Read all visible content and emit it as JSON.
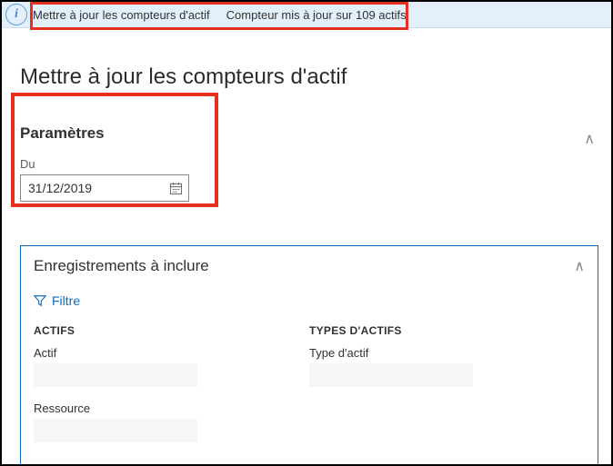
{
  "info_bar": {
    "message_a": "Mettre à jour les compteurs d'actif",
    "message_b": "Compteur mis à jour sur 109 actifs"
  },
  "page_title": "Mettre à jour les compteurs d'actif",
  "params": {
    "section_title": "Paramètres",
    "date_label": "Du",
    "date_value": "31/12/2019"
  },
  "records": {
    "section_title": "Enregistrements à inclure",
    "filter_label": "Filtre",
    "col_a_heading": "ACTIFS",
    "col_a_field1": "Actif",
    "col_a_field2": "Ressource",
    "col_b_heading": "TYPES D'ACTIFS",
    "col_b_field1": "Type d'actif"
  }
}
